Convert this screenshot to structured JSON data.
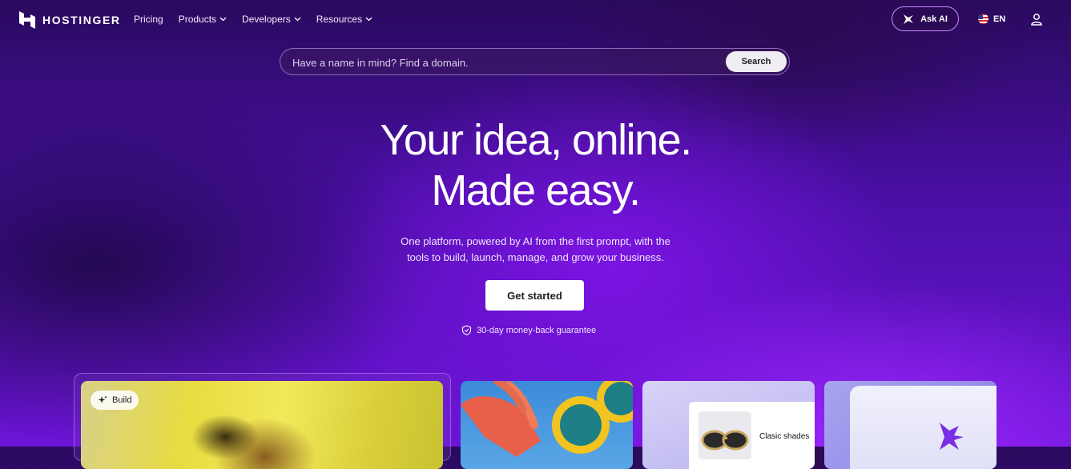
{
  "brand": {
    "name": "HOSTINGER"
  },
  "nav": {
    "items": [
      {
        "label": "Pricing",
        "has_dropdown": false
      },
      {
        "label": "Products",
        "has_dropdown": true
      },
      {
        "label": "Developers",
        "has_dropdown": true
      },
      {
        "label": "Resources",
        "has_dropdown": true
      }
    ],
    "ask_ai_label": "Ask AI",
    "language_label": "EN"
  },
  "search": {
    "placeholder": "Have a name in mind? Find a domain.",
    "value": "",
    "button_label": "Search"
  },
  "hero": {
    "title_line1": "Your idea, online.",
    "title_line2": "Made easy.",
    "subtitle_line1": "One platform, powered by AI from the first prompt, with the",
    "subtitle_line2": "tools to build, launch, manage, and grow your business.",
    "cta_label": "Get started",
    "guarantee": "30-day money-back guarantee"
  },
  "cards": {
    "build_tag": "Build",
    "shop_product": "Clasic shades"
  },
  "colors": {
    "accent": "#673de6",
    "background": "#4a0fa6",
    "cta_bg": "#ffffff",
    "ask_ai_border": "#c98cff"
  },
  "icons": [
    "hostinger-logo-icon",
    "chevron-down-icon",
    "ask-ai-icon",
    "us-flag-icon",
    "user-icon",
    "shield-check-icon",
    "sparkle-icon",
    "hostinger-agent-icon"
  ]
}
